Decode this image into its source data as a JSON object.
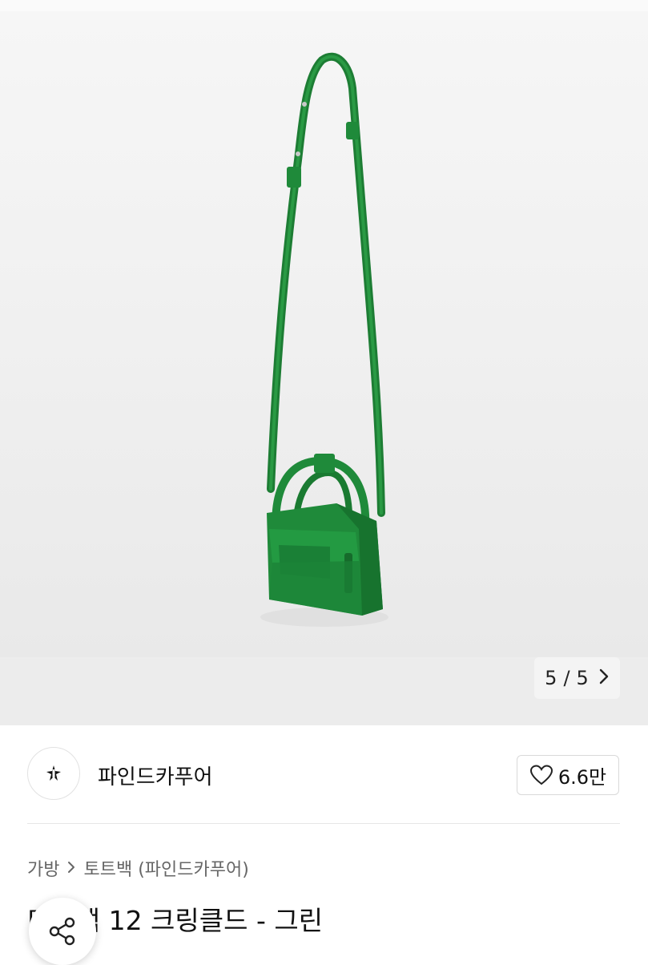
{
  "gallery": {
    "current": "5",
    "separator": "/",
    "total": "5",
    "next_icon": "chevron-right-icon",
    "product_image": "green-mini-tote-bag"
  },
  "seller": {
    "name": "파인드카푸어",
    "avatar_icon": "findkapoor-logo-icon"
  },
  "like": {
    "icon": "heart-outline-icon",
    "count": "6.6만"
  },
  "breadcrumb": {
    "items": [
      "가방",
      "토트백 (파인드카푸어)"
    ],
    "separator_icon": "chevron-right-icon"
  },
  "product": {
    "title": "미니백 12 크링클드 - 그린"
  },
  "share": {
    "icon": "share-icon"
  },
  "colors": {
    "bag_green": "#1f8a3a",
    "background": "#ededed"
  }
}
